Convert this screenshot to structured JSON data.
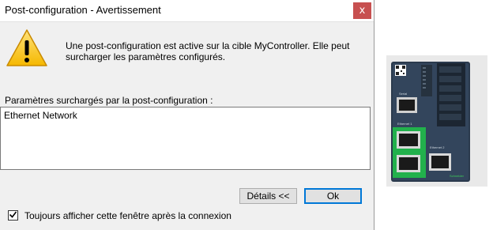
{
  "dialog": {
    "title": "Post-configuration - Avertissement",
    "close_label": "x",
    "message": "Une post-configuration est active sur la cible MyController. Elle peut surcharger les paramètres configurés.",
    "group_label": "Paramètres surchargés par la post-configuration :",
    "list_items": [
      "Ethernet Network"
    ],
    "details_button": "Détails <<",
    "ok_button": "Ok",
    "checkbox_checked": true,
    "checkbox_label": "Toujours afficher cette fenêtre après la connexion"
  },
  "device": {
    "label_serial": "Serial",
    "label_ethernet1": "Ethernet 1",
    "label_ethernet2": "Ethernet 2",
    "brand": "Schneider",
    "colors": {
      "body": "#2b3a4d",
      "highlight": "#22b14c",
      "accent": "#3dcd58"
    }
  },
  "icons": {
    "warning": "warning-triangle-icon",
    "close": "close-icon",
    "check": "checkmark-icon"
  }
}
